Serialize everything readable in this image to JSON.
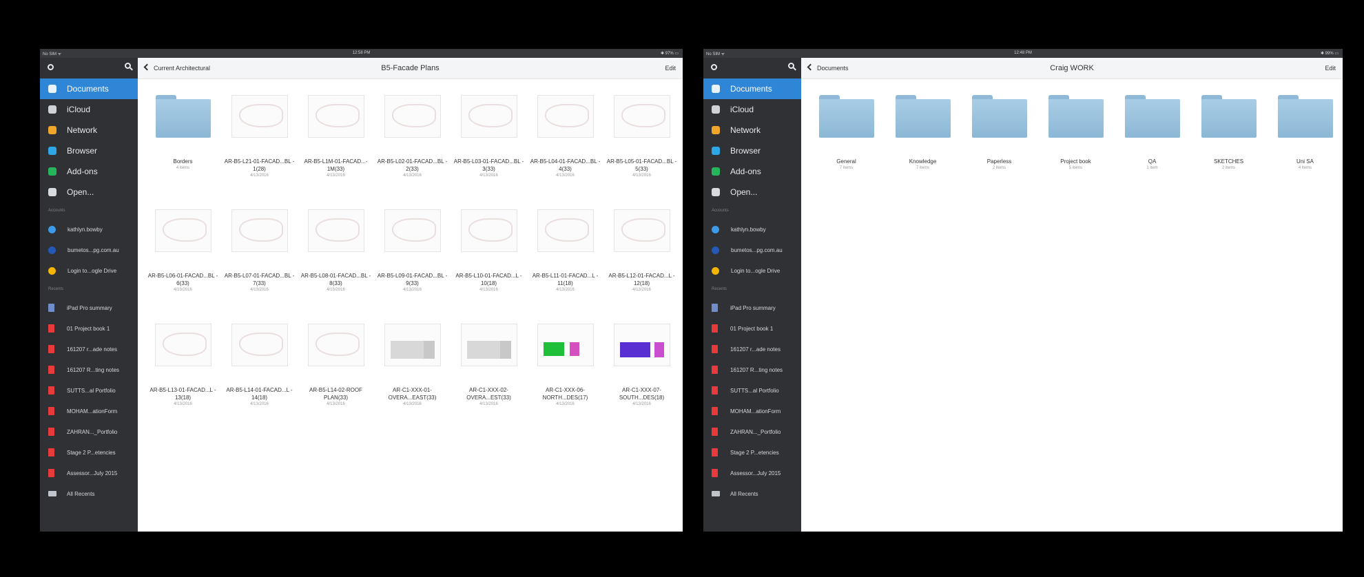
{
  "left": {
    "status": {
      "carrier": "No SIM ᯤ",
      "time": "12:58 PM",
      "battery": "✱ 97% ▭"
    },
    "nav": [
      {
        "label": "Documents",
        "icon": "document-icon",
        "color": "#2f86d6",
        "active": true
      },
      {
        "label": "iCloud",
        "icon": "cloud-icon",
        "color": "#cfd3d8"
      },
      {
        "label": "Network",
        "icon": "network-icon",
        "color": "#f0a52b"
      },
      {
        "label": "Browser",
        "icon": "browser-icon",
        "color": "#2ea7e6"
      },
      {
        "label": "Add-ons",
        "icon": "addons-icon",
        "color": "#27b55c"
      },
      {
        "label": "Open...",
        "icon": "folder-icon",
        "color": "#d7dbe0"
      }
    ],
    "accounts_label": "Accounts",
    "accounts": [
      {
        "label": "kathlyn.bowby",
        "icon": "dropbox-icon",
        "color": "#3d9ae8"
      },
      {
        "label": "bumetos...pg.com.au",
        "icon": "onedrive-icon",
        "color": "#2459b8"
      },
      {
        "label": "Login to...ogle Drive",
        "icon": "google-drive-icon",
        "color": "#f4b400"
      }
    ],
    "recents_label": "Recents",
    "recents": [
      {
        "label": "iPad Pro summary",
        "type": "word"
      },
      {
        "label": "01 Project book 1",
        "type": "pdf"
      },
      {
        "label": "161207 r...ade notes",
        "type": "pdf"
      },
      {
        "label": "161207 R...ting notes",
        "type": "pdf"
      },
      {
        "label": "SUTTS...al Portfolio",
        "type": "pdf"
      },
      {
        "label": "MOHAM...ationForm",
        "type": "pdf"
      },
      {
        "label": "ZAHRAN..._Portfolio",
        "type": "pdf"
      },
      {
        "label": "Stage 2 P...etencies",
        "type": "pdf"
      },
      {
        "label": "Assessor...July 2015",
        "type": "pdf"
      },
      {
        "label": "All Recents",
        "type": "folder"
      }
    ],
    "back_label": "Current Architectural",
    "title": "B5-Facade Plans",
    "edit_label": "Edit",
    "items": [
      {
        "name": "Borders",
        "sub": "4 items",
        "kind": "folder"
      },
      {
        "name": "AR-B5-L21-01-FACAD...BL - 1(28)",
        "sub": "4/13/2016",
        "kind": "plan"
      },
      {
        "name": "AR-B5-L1M-01-FACAD...- 1M(33)",
        "sub": "4/13/2016",
        "kind": "plan"
      },
      {
        "name": "AR-B5-L02-01-FACAD...BL - 2(33)",
        "sub": "4/13/2016",
        "kind": "plan"
      },
      {
        "name": "AR-B5-L03-01-FACAD...BL - 3(33)",
        "sub": "4/13/2016",
        "kind": "plan"
      },
      {
        "name": "AR-B5-L04-01-FACAD...BL - 4(33)",
        "sub": "4/13/2016",
        "kind": "plan"
      },
      {
        "name": "AR-B5-L05-01-FACAD...BL - 5(33)",
        "sub": "4/13/2016",
        "kind": "plan"
      },
      {
        "name": "AR-B5-L06-01-FACAD...BL - 6(33)",
        "sub": "4/13/2016",
        "kind": "plan"
      },
      {
        "name": "AR-B5-L07-01-FACAD...BL - 7(33)",
        "sub": "4/13/2016",
        "kind": "plan"
      },
      {
        "name": "AR-B5-L08-01-FACAD...BL - 8(33)",
        "sub": "4/13/2016",
        "kind": "plan"
      },
      {
        "name": "AR-B5-L09-01-FACAD...BL - 9(33)",
        "sub": "4/13/2016",
        "kind": "plan"
      },
      {
        "name": "AR-B5-L10-01-FACAD...L - 10(18)",
        "sub": "4/13/2016",
        "kind": "plan"
      },
      {
        "name": "AR-B5-L11-01-FACAD...L - 11(18)",
        "sub": "4/13/2016",
        "kind": "plan"
      },
      {
        "name": "AR-B5-L12-01-FACAD...L - 12(18)",
        "sub": "4/13/2016",
        "kind": "plan"
      },
      {
        "name": "AR-B5-L13-01-FACAD...L - 13(18)",
        "sub": "4/13/2016",
        "kind": "plan"
      },
      {
        "name": "AR-B5-L14-01-FACAD...L - 14(18)",
        "sub": "4/13/2016",
        "kind": "plan"
      },
      {
        "name": "AR-B5-L14-02-ROOF PLAN(33)",
        "sub": "4/13/2016",
        "kind": "plan"
      },
      {
        "name": "AR-C1-XXX-01-OVERA...EAST(33)",
        "sub": "4/13/2016",
        "kind": "elev"
      },
      {
        "name": "AR-C1-XXX-02-OVERA...EST(33)",
        "sub": "4/13/2016",
        "kind": "elev"
      },
      {
        "name": "AR-C1-XXX-06-NORTH...DES(17)",
        "sub": "4/13/2016",
        "kind": "green"
      },
      {
        "name": "AR-C1-XXX-07-SOUTH...DES(18)",
        "sub": "4/13/2016",
        "kind": "purple"
      }
    ]
  },
  "right": {
    "status": {
      "carrier": "No SIM ᯤ",
      "time": "12:48 PM",
      "battery": "✱ 99% ▭"
    },
    "nav": [
      {
        "label": "Documents",
        "icon": "document-icon",
        "color": "#2f86d6",
        "active": true
      },
      {
        "label": "iCloud",
        "icon": "cloud-icon",
        "color": "#cfd3d8"
      },
      {
        "label": "Network",
        "icon": "network-icon",
        "color": "#f0a52b"
      },
      {
        "label": "Browser",
        "icon": "browser-icon",
        "color": "#2ea7e6"
      },
      {
        "label": "Add-ons",
        "icon": "addons-icon",
        "color": "#27b55c"
      },
      {
        "label": "Open...",
        "icon": "folder-icon",
        "color": "#d7dbe0"
      }
    ],
    "accounts_label": "Accounts",
    "accounts": [
      {
        "label": "kathlyn.bowby",
        "icon": "dropbox-icon",
        "color": "#3d9ae8"
      },
      {
        "label": "bumetos...pg.com.au",
        "icon": "onedrive-icon",
        "color": "#2459b8"
      },
      {
        "label": "Login to...ogle Drive",
        "icon": "google-drive-icon",
        "color": "#f4b400"
      }
    ],
    "recents_label": "Recents",
    "recents": [
      {
        "label": "iPad Pro summary",
        "type": "word"
      },
      {
        "label": "01 Project book 1",
        "type": "pdf"
      },
      {
        "label": "161207 r...ade notes",
        "type": "pdf"
      },
      {
        "label": "161207 R...ting notes",
        "type": "pdf"
      },
      {
        "label": "SUTTS...al Portfolio",
        "type": "pdf"
      },
      {
        "label": "MOHAM...ationForm",
        "type": "pdf"
      },
      {
        "label": "ZAHRAN..._Portfolio",
        "type": "pdf"
      },
      {
        "label": "Stage 2 P...etencies",
        "type": "pdf"
      },
      {
        "label": "Assessor...July 2015",
        "type": "pdf"
      },
      {
        "label": "All Recents",
        "type": "folder"
      }
    ],
    "back_label": "Documents",
    "title": "Craig WORK",
    "edit_label": "Edit",
    "items": [
      {
        "name": "General",
        "sub": "7 items",
        "kind": "folder"
      },
      {
        "name": "Knowledge",
        "sub": "7 items",
        "kind": "folder"
      },
      {
        "name": "Paperless",
        "sub": "2 items",
        "kind": "folder"
      },
      {
        "name": "Project book",
        "sub": "5 items",
        "kind": "folder"
      },
      {
        "name": "QA",
        "sub": "1 item",
        "kind": "folder"
      },
      {
        "name": "SKETCHES",
        "sub": "2 items",
        "kind": "folder"
      },
      {
        "name": "Uni SA",
        "sub": "4 items",
        "kind": "folder"
      }
    ]
  }
}
